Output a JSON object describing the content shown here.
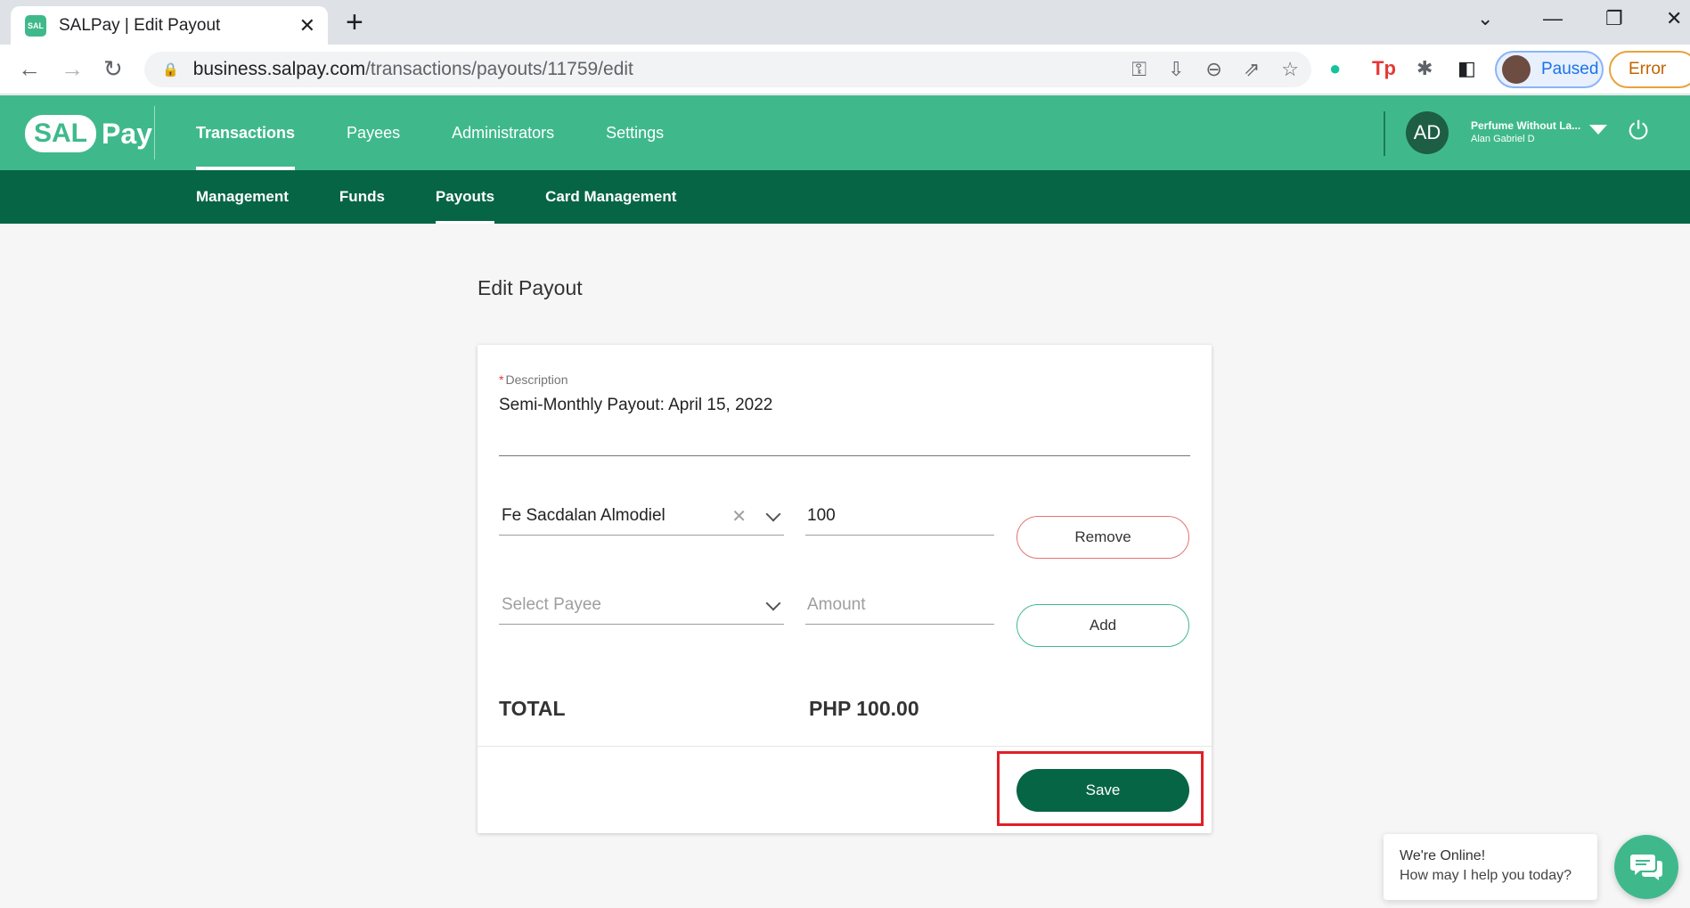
{
  "browser": {
    "tab_title": "SALPay | Edit Payout",
    "favicon_text": "SAL",
    "url_domain": "business.salpay.com",
    "url_path": "/transactions/payouts/11759/edit",
    "profile_status": "Paused",
    "error_label": "Error"
  },
  "header": {
    "logo_sal": "SAL",
    "logo_pay": "Pay",
    "nav": [
      {
        "label": "Transactions"
      },
      {
        "label": "Payees"
      },
      {
        "label": "Administrators"
      },
      {
        "label": "Settings"
      }
    ],
    "user_initials": "AD",
    "user_org": "Perfume Without La...",
    "user_name": "Alan Gabriel D"
  },
  "subnav": [
    {
      "label": "Management"
    },
    {
      "label": "Funds"
    },
    {
      "label": "Payouts"
    },
    {
      "label": "Card Management"
    }
  ],
  "page": {
    "title": "Edit Payout",
    "description_label": "Description",
    "description_value": "Semi-Monthly Payout: April 15, 2022",
    "rows": [
      {
        "payee": "Fe Sacdalan Almodiel",
        "amount": "100",
        "action": "Remove"
      }
    ],
    "new_row": {
      "payee_placeholder": "Select Payee",
      "amount_placeholder": "Amount",
      "action": "Add"
    },
    "total_label": "TOTAL",
    "total_value": "PHP 100.00",
    "save_label": "Save"
  },
  "chat": {
    "title": "We're Online!",
    "subtitle": "How may I help you today?"
  },
  "colors": {
    "brand_green": "#3fb98c",
    "dark_green": "#066545",
    "highlight_red": "#e21f26"
  }
}
